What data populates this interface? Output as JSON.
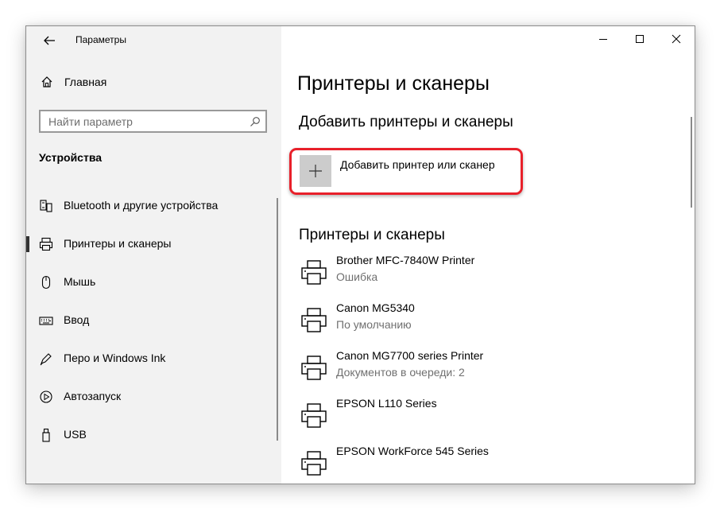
{
  "window": {
    "title": "Параметры"
  },
  "sidebar": {
    "home_label": "Главная",
    "search_placeholder": "Найти параметр",
    "section_title": "Устройства",
    "items": [
      {
        "label": "Bluetooth и другие устройства",
        "icon": "bluetooth-devices-icon",
        "selected": false
      },
      {
        "label": "Принтеры и сканеры",
        "icon": "printer-icon",
        "selected": true
      },
      {
        "label": "Мышь",
        "icon": "mouse-icon",
        "selected": false
      },
      {
        "label": "Ввод",
        "icon": "keyboard-icon",
        "selected": false
      },
      {
        "label": "Перо и Windows Ink",
        "icon": "pen-icon",
        "selected": false
      },
      {
        "label": "Автозапуск",
        "icon": "autoplay-icon",
        "selected": false
      },
      {
        "label": "USB",
        "icon": "usb-icon",
        "selected": false
      }
    ]
  },
  "main": {
    "page_title": "Принтеры и сканеры",
    "add_section_title": "Добавить принтеры и сканеры",
    "add_button_label": "Добавить принтер или сканер",
    "list_title": "Принтеры и сканеры",
    "printers": [
      {
        "name": "Brother MFC-7840W Printer",
        "status": "Ошибка"
      },
      {
        "name": "Canon MG5340",
        "status": "По умолчанию"
      },
      {
        "name": "Canon MG7700 series Printer",
        "status": "Документов в очереди: 2"
      },
      {
        "name": "EPSON L110 Series",
        "status": ""
      },
      {
        "name": "EPSON WorkForce 545 Series",
        "status": ""
      }
    ]
  },
  "colors": {
    "sidebar_bg": "#f2f2f2",
    "highlight_border": "#e8202a",
    "add_button_bg": "#cccccc",
    "status_text": "#707070"
  }
}
